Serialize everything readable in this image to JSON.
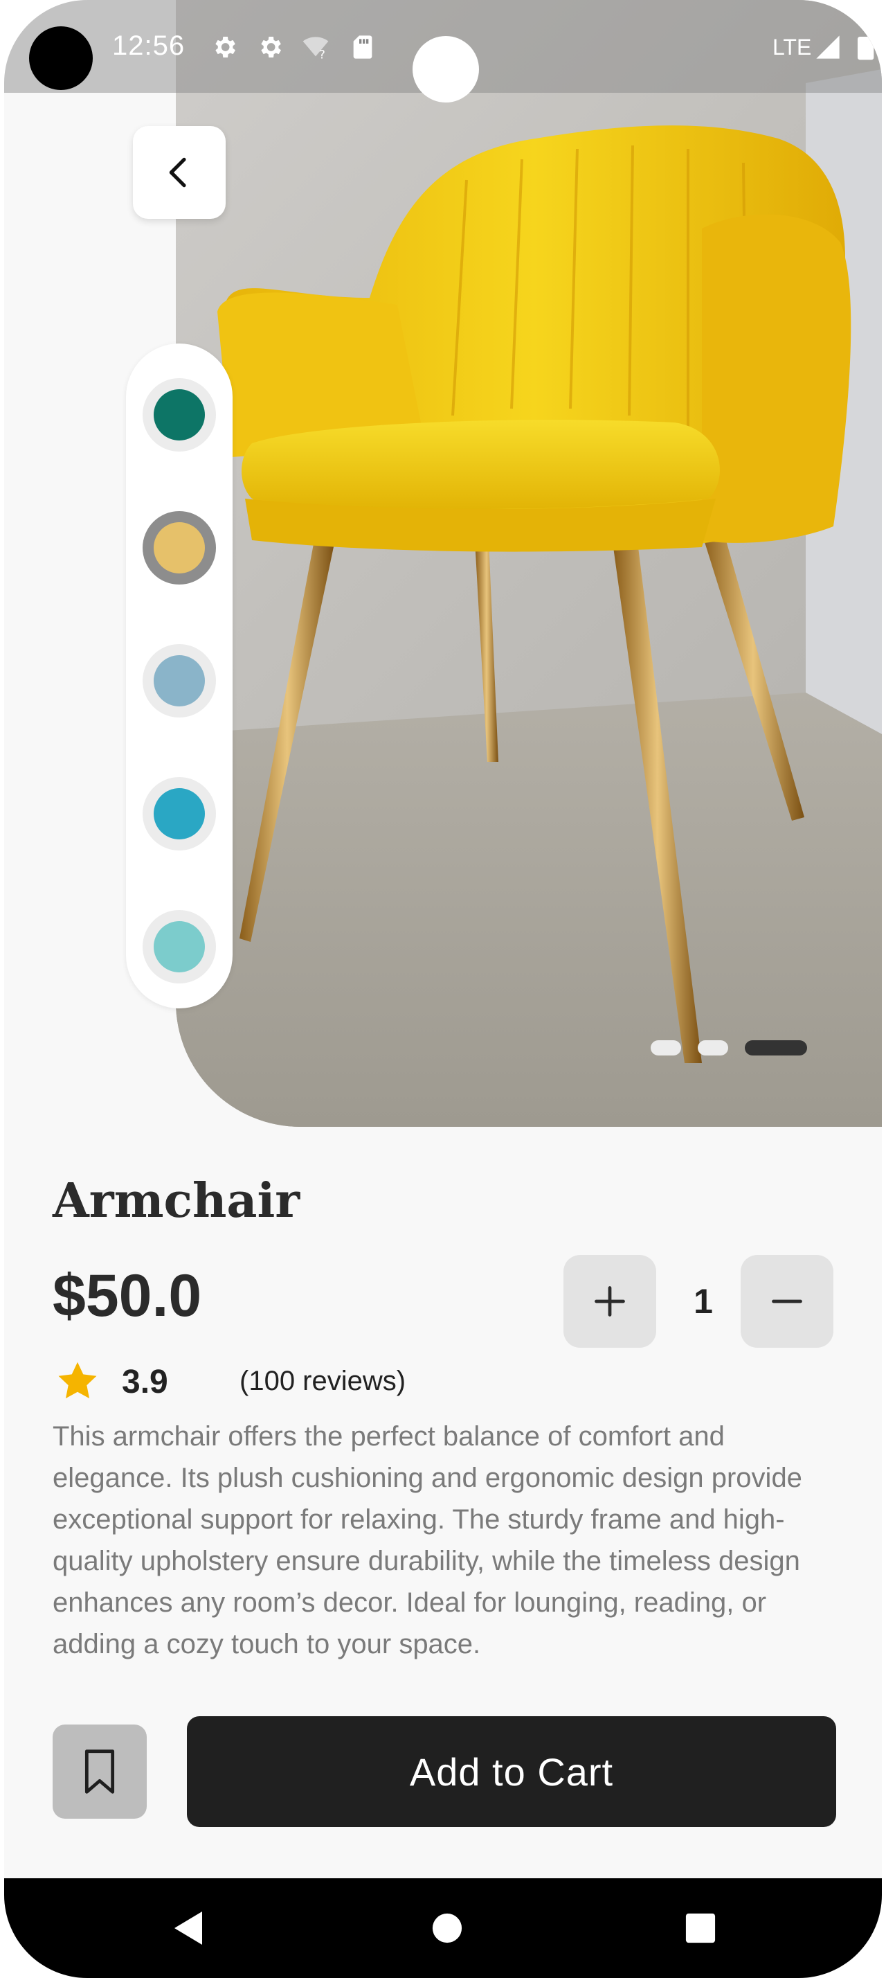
{
  "status_bar": {
    "time": "12:56",
    "network": "LTE",
    "icons": [
      "settings-icon",
      "settings-icon",
      "wifi-question-icon",
      "sim-card-icon",
      "signal-icon",
      "battery-icon"
    ]
  },
  "hero": {
    "image": "yellow-velvet-armchair-photo",
    "colors": [
      "#0d7566",
      "#e6c16a",
      "#8ab4c9",
      "#2aa7c4",
      "#7ccccc"
    ],
    "selected_color_index": 1,
    "carousel": {
      "count": 3,
      "active_index": 2
    }
  },
  "product": {
    "title": "Armchair",
    "price": "$50.0",
    "quantity": "1",
    "rating": "3.9",
    "reviews": "(100 reviews)",
    "description": "This armchair offers the perfect balance of comfort and elegance. Its plush cushioning and ergonomic design provide exceptional support for relaxing. The sturdy frame and high-quality upholstery ensure durability, while the timeless design enhances any room’s decor. Ideal for lounging, reading, or adding a cozy touch to your space."
  },
  "actions": {
    "add_to_cart": "Add to Cart"
  },
  "theme": {
    "accent_star": "#f5b400",
    "dark_button": "#202020"
  }
}
